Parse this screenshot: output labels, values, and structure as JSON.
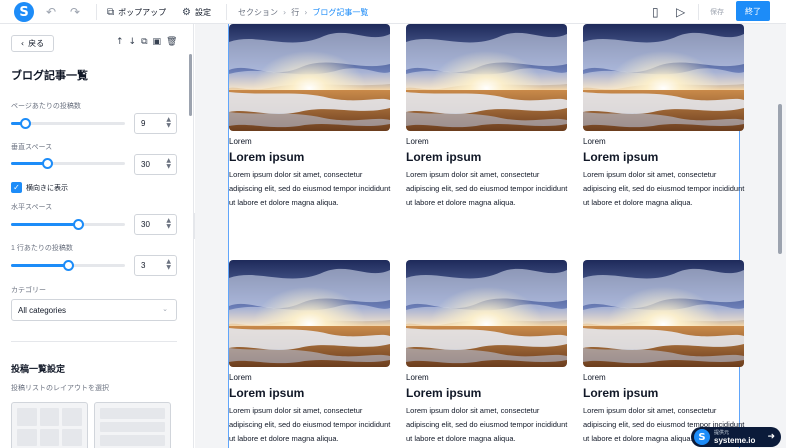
{
  "topbar": {
    "popup_label": "ポップアップ",
    "settings_label": "設定",
    "breadcrumbs": [
      "セクション",
      "行",
      "ブログ記事一覧"
    ],
    "save_label": "保存",
    "finish_label": "終了"
  },
  "sidebar": {
    "back_label": "戻る",
    "title": "ブログ記事一覧",
    "posts_per_page": {
      "label": "ページあたりの投稿数",
      "value": "9",
      "fill": 0.12
    },
    "vertical_space": {
      "label": "垂直スペース",
      "value": "30",
      "fill": 0.32
    },
    "horizontal_toggle": {
      "label": "横向きに表示",
      "checked": true
    },
    "horizontal_space": {
      "label": "水平スペース",
      "value": "30",
      "fill": 0.59
    },
    "posts_per_row": {
      "label": "1 行あたりの投稿数",
      "value": "3",
      "fill": 0.5
    },
    "category": {
      "label": "カテゴリー",
      "value": "All categories"
    },
    "section_title": "投稿一覧設定",
    "section_sub": "投稿リストのレイアウトを選択"
  },
  "cards": [
    {
      "category": "Lorem",
      "title": "Lorem ipsum",
      "desc": "Lorem ipsum dolor sit amet, consectetur adipiscing elit, sed do eiusmod tempor incididunt ut labore et dolore magna aliqua."
    },
    {
      "category": "Lorem",
      "title": "Lorem ipsum",
      "desc": "Lorem ipsum dolor sit amet, consectetur adipiscing elit, sed do eiusmod tempor incididunt ut labore et dolore magna aliqua."
    },
    {
      "category": "Lorem",
      "title": "Lorem ipsum",
      "desc": "Lorem ipsum dolor sit amet, consectetur adipiscing elit, sed do eiusmod tempor incididunt ut labore et dolore magna aliqua."
    },
    {
      "category": "Lorem",
      "title": "Lorem ipsum",
      "desc": "Lorem ipsum dolor sit amet, consectetur adipiscing elit, sed do eiusmod tempor incididunt ut labore et dolore magna aliqua."
    },
    {
      "category": "Lorem",
      "title": "Lorem ipsum",
      "desc": "Lorem ipsum dolor sit amet, consectetur adipiscing elit, sed do eiusmod tempor incididunt ut labore et dolore magna aliqua."
    },
    {
      "category": "Lorem",
      "title": "Lorem ipsum",
      "desc": "Lorem ipsum dolor sit amet, consectetur adipiscing elit, sed do eiusmod tempor incididunt ut labore et dolore magna aliqua."
    }
  ],
  "badge": {
    "small": "提供元",
    "brand": "systeme.io"
  },
  "colors": {
    "accent": "#1d8cf8",
    "dark": "#0b1b3a"
  }
}
